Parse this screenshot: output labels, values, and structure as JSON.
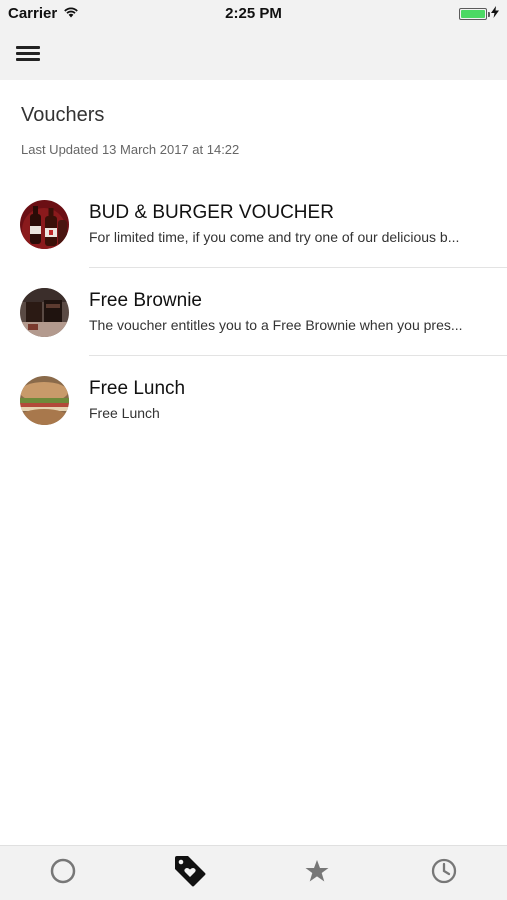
{
  "status_bar": {
    "carrier": "Carrier",
    "time": "2:25 PM",
    "battery_level": 1.0
  },
  "navbar": {
    "menu_icon": "hamburger-menu-icon"
  },
  "page": {
    "title": "Vouchers",
    "last_updated": "Last Updated 13 March 2017 at 14:22"
  },
  "vouchers": [
    {
      "title": "BUD & BURGER VOUCHER",
      "description": "For limited time, if you come and try one of our delicious b...",
      "image": "beer-bottles-image"
    },
    {
      "title": "Free Brownie",
      "description": "The voucher entitles you to a Free Brownie when you pres...",
      "image": "brownie-image"
    },
    {
      "title": "Free Lunch",
      "description": "Free Lunch",
      "image": "sandwich-image"
    }
  ],
  "tabbar": {
    "tabs": [
      {
        "icon": "circle-icon",
        "active": false
      },
      {
        "icon": "tag-heart-icon",
        "active": true
      },
      {
        "icon": "star-icon",
        "active": false
      },
      {
        "icon": "clock-icon",
        "active": false
      }
    ]
  },
  "colors": {
    "bar_background": "#f2f2f2",
    "battery": "#4cd964",
    "tab_inactive": "#777777",
    "tab_active": "#111111"
  }
}
